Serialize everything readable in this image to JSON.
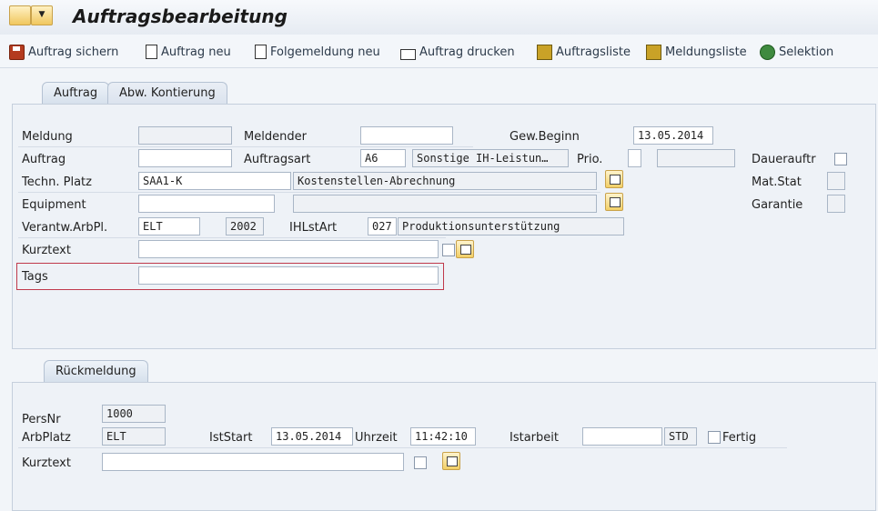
{
  "app": {
    "title": "Auftragsbearbeitung"
  },
  "toolbar": {
    "save": "Auftrag sichern",
    "new_order": "Auftrag neu",
    "new_followup": "Folgemeldung neu",
    "print": "Auftrag drucken",
    "order_list": "Auftragsliste",
    "notification_list": "Meldungsliste",
    "selection": "Selektion"
  },
  "tabs": {
    "order": "Auftrag",
    "account": "Abw. Kontierung",
    "confirmation": "Rückmeldung"
  },
  "order": {
    "meldung": {
      "label": "Meldung",
      "value": ""
    },
    "meldender": {
      "label": "Meldender",
      "value": ""
    },
    "gew_beginn": {
      "label": "Gew.Beginn",
      "value": "13.05.2014"
    },
    "auftrag": {
      "label": "Auftrag",
      "value": ""
    },
    "auftragsart": {
      "label": "Auftragsart",
      "value": "A6",
      "text": "Sonstige IH-Leistun…"
    },
    "prio": {
      "label": "Prio.",
      "value": "",
      "text": ""
    },
    "dauerauftr": {
      "label": "Dauerauftr"
    },
    "techn_platz": {
      "label": "Techn. Platz",
      "value": "SAA1-K",
      "text": "Kostenstellen-Abrechnung"
    },
    "mat_stat": {
      "label": "Mat.Stat"
    },
    "equipment": {
      "label": "Equipment",
      "value": "",
      "text": ""
    },
    "garantie": {
      "label": "Garantie"
    },
    "verantw": {
      "label": "Verantw.ArbPl.",
      "value": "ELT",
      "plant": "2002"
    },
    "ihlstart": {
      "label": "IHLstArt",
      "value": "027",
      "text": "Produktionsunterstützung"
    },
    "kurztext": {
      "label": "Kurztext",
      "value": ""
    },
    "tags": {
      "label": "Tags",
      "value": ""
    }
  },
  "confirmation": {
    "persnr": {
      "label": "PersNr",
      "value": "1000"
    },
    "arbplatz": {
      "label": "ArbPlatz",
      "value": "ELT"
    },
    "iststart": {
      "label": "IstStart",
      "value": "13.05.2014"
    },
    "uhrzeit": {
      "label": "Uhrzeit",
      "value": "11:42:10"
    },
    "istarbeit": {
      "label": "Istarbeit",
      "value": "",
      "unit": "STD"
    },
    "fertig": {
      "label": "Fertig"
    },
    "kurztext": {
      "label": "Kurztext",
      "value": ""
    }
  }
}
